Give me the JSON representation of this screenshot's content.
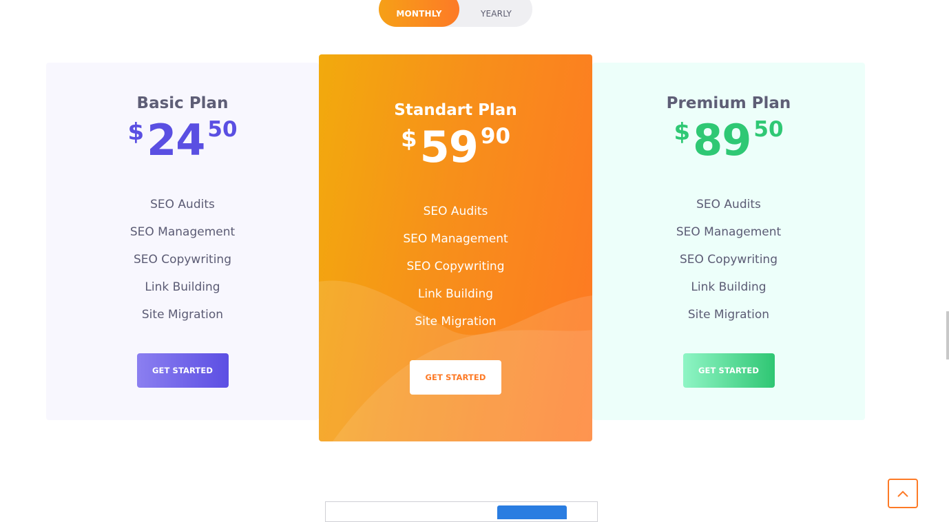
{
  "billing_toggle": {
    "monthly_label": "MONTHLY",
    "yearly_label": "YEARLY",
    "active": "monthly"
  },
  "plans": [
    {
      "title": "Basic Plan",
      "currency": "$",
      "price_main": "24",
      "price_cents": "50",
      "features": [
        "SEO Audits",
        "SEO Management",
        "SEO Copywriting",
        "Link Building",
        "Site Migration"
      ],
      "button_label": "GET STARTED",
      "accent_color": "#5a4fe2"
    },
    {
      "title": "Standart Plan",
      "currency": "$",
      "price_main": "59",
      "price_cents": "90",
      "features": [
        "SEO Audits",
        "SEO Management",
        "SEO Copywriting",
        "Link Building",
        "Site Migration"
      ],
      "button_label": "GET STARTED",
      "accent_color": "#fd7a26"
    },
    {
      "title": "Premium Plan",
      "currency": "$",
      "price_main": "89",
      "price_cents": "50",
      "features": [
        "SEO Audits",
        "SEO Management",
        "SEO Copywriting",
        "Link Building",
        "Site Migration"
      ],
      "button_label": "GET STARTED",
      "accent_color": "#2fc874"
    }
  ],
  "back_to_top": {
    "icon": "chevron-up-icon"
  }
}
